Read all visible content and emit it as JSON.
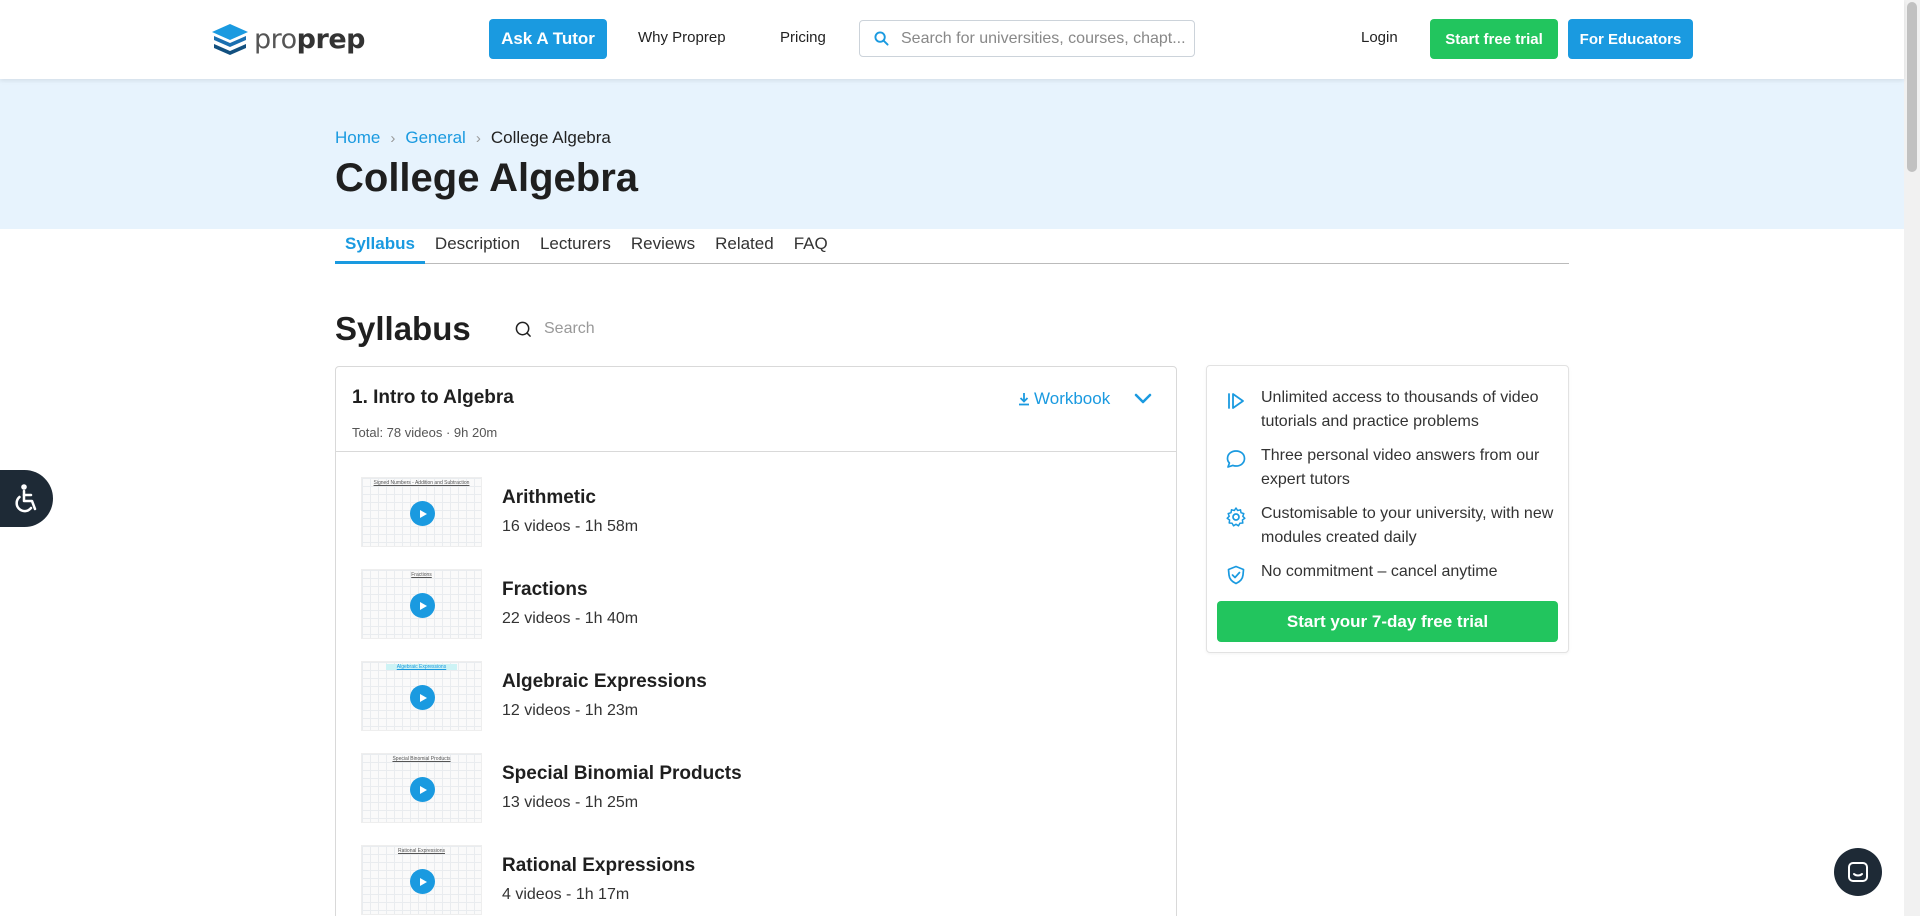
{
  "header": {
    "logo_text_light": "pro",
    "logo_text_bold": "prep",
    "ask_tutor": "Ask A Tutor",
    "why": "Why Proprep",
    "pricing": "Pricing",
    "search_placeholder": "Search for universities, courses, chapt...",
    "login": "Login",
    "start_trial": "Start free trial",
    "educators": "For Educators"
  },
  "breadcrumb": {
    "home": "Home",
    "general": "General",
    "current": "College Algebra"
  },
  "page_title": "College Algebra",
  "tabs": [
    "Syllabus",
    "Description",
    "Lecturers",
    "Reviews",
    "Related",
    "FAQ"
  ],
  "syllabus": {
    "title": "Syllabus",
    "search_placeholder": "Search",
    "chapter": {
      "title": "1. Intro to Algebra",
      "total": "Total: 78 videos · 9h 20m",
      "workbook": "Workbook",
      "lessons": [
        {
          "name": "Arithmetic",
          "meta": "16 videos - 1h 58m",
          "thumb_caption": "Signed Numbers - Addition and Subtraction"
        },
        {
          "name": "Fractions",
          "meta": "22 videos - 1h 40m",
          "thumb_caption": "Fractions"
        },
        {
          "name": "Algebraic Expressions",
          "meta": "12 videos - 1h 23m",
          "thumb_caption": "Algebraic Expressions"
        },
        {
          "name": "Special Binomial Products",
          "meta": "13 videos - 1h 25m",
          "thumb_caption": "Special Binomial Products"
        },
        {
          "name": "Rational Expressions",
          "meta": "4 videos - 1h 17m",
          "thumb_caption": "Rational Expressions"
        }
      ]
    }
  },
  "card": {
    "features": [
      "Unlimited access to thousands of video tutorials and practice problems",
      "Three personal video answers from our expert tutors",
      "Customisable to your university, with new modules created daily",
      "No commitment – cancel anytime"
    ],
    "cta": "Start your 7-day free trial"
  },
  "colors": {
    "brand_blue": "#1a9ae0",
    "brand_green": "#22c55e",
    "hero_bg": "#e7f3fd",
    "dark_navy": "#1e2a36"
  }
}
